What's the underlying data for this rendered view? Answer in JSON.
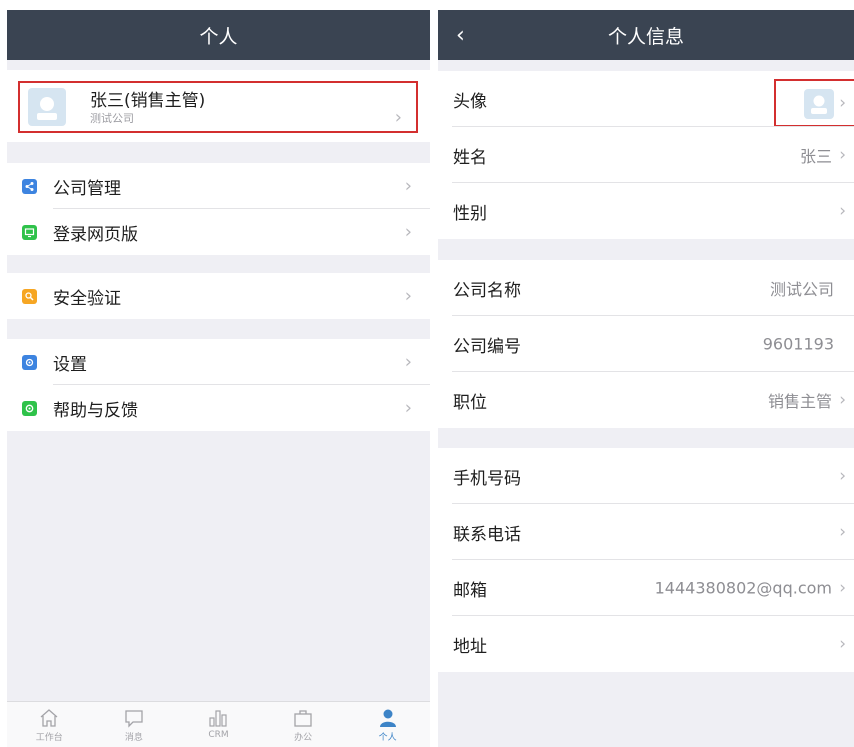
{
  "left": {
    "nav_title": "个人",
    "profile": {
      "name": "张三(销售主管)",
      "company": "测试公司"
    },
    "group1": [
      {
        "label": "公司管理",
        "icon": "share-icon",
        "color": "#3d84e0"
      },
      {
        "label": "登录网页版",
        "icon": "monitor-icon",
        "color": "#2fc24a"
      }
    ],
    "group2": [
      {
        "label": "安全验证",
        "icon": "search-icon",
        "color": "#f6a623"
      }
    ],
    "group3": [
      {
        "label": "设置",
        "icon": "gear-icon",
        "color": "#3d84e0"
      },
      {
        "label": "帮助与反馈",
        "icon": "help-icon",
        "color": "#2fc24a"
      }
    ],
    "tabs": [
      {
        "label": "工作台",
        "icon": "home-icon",
        "active": false
      },
      {
        "label": "消息",
        "icon": "chat-icon",
        "active": false
      },
      {
        "label": "CRM",
        "icon": "chart-icon",
        "active": false
      },
      {
        "label": "办公",
        "icon": "briefcase-icon",
        "active": false
      },
      {
        "label": "个人",
        "icon": "person-icon",
        "active": true
      }
    ],
    "active_color": "#3d84c7"
  },
  "right": {
    "nav_title": "个人信息",
    "back_glyph": "‹",
    "section1": [
      {
        "label": "头像",
        "value": ""
      },
      {
        "label": "姓名",
        "value": "张三"
      },
      {
        "label": "性别",
        "value": ""
      }
    ],
    "section2": [
      {
        "label": "公司名称",
        "value": "测试公司"
      },
      {
        "label": "公司编号",
        "value": "9601193"
      },
      {
        "label": "职位",
        "value": "销售主管"
      }
    ],
    "section3": [
      {
        "label": "手机号码",
        "value": ""
      },
      {
        "label": "联系电话",
        "value": ""
      },
      {
        "label": "邮箱",
        "value": "1444380802@qq.com"
      },
      {
        "label": "地址",
        "value": ""
      }
    ]
  },
  "chevron": "›",
  "highlight_color": "#d32f2f"
}
